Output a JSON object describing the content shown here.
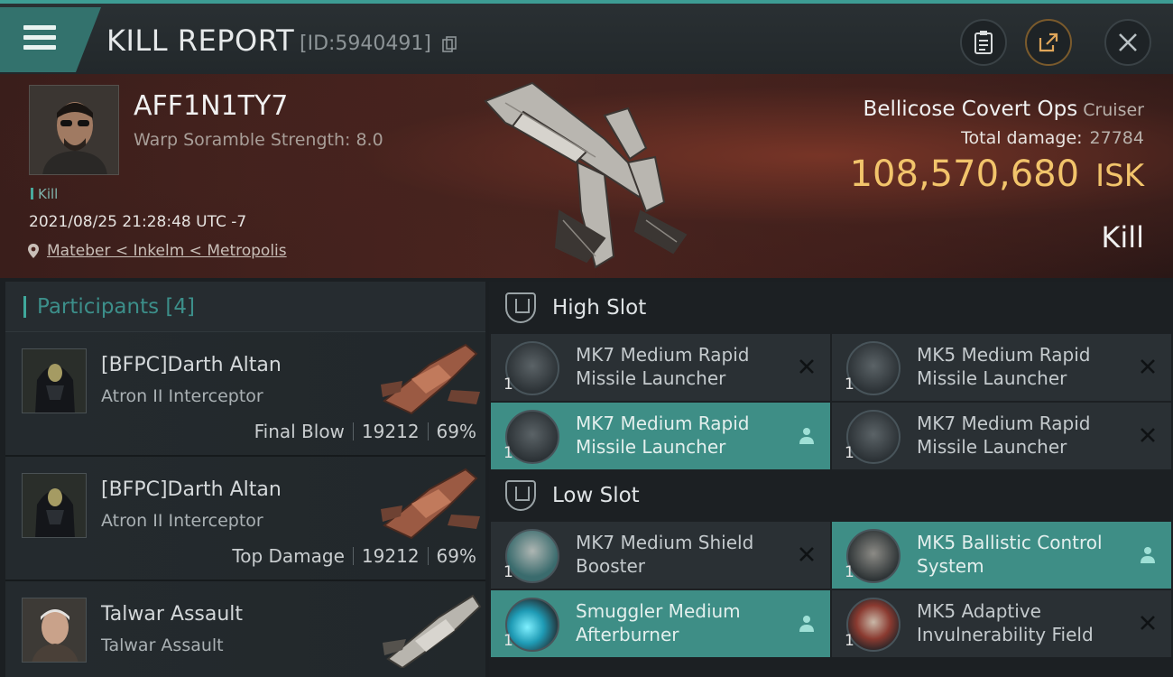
{
  "header": {
    "title": "KILL REPORT",
    "report_id": "[ID:5940491]"
  },
  "victim": {
    "name": "AFF1N1TY7",
    "scramble": "Warp Soramble Strength: 8.0",
    "tag": "Kill",
    "datetime": "2021/08/25 21:28:48 UTC -7",
    "location": "Mateber < Inkelm < Metropolis",
    "ship_name": "Bellicose Covert Ops",
    "ship_class": "Cruiser",
    "total_damage_label": "Total damage:",
    "total_damage": "27784",
    "isk_value": "108,570,680",
    "isk_unit": "ISK",
    "result": "Kill"
  },
  "participants": {
    "heading": "Participants [4]",
    "rows": [
      {
        "name": "[BFPC]Darth Altan",
        "ship": "Atron II Interceptor",
        "role": "Final Blow",
        "damage": "19212",
        "percent": "69%"
      },
      {
        "name": "[BFPC]Darth Altan",
        "ship": "Atron II Interceptor",
        "role": "Top Damage",
        "damage": "19212",
        "percent": "69%"
      },
      {
        "name": "Talwar Assault",
        "ship": "Talwar Assault",
        "role": "",
        "damage": "",
        "percent": ""
      }
    ]
  },
  "fitting": {
    "high_slot_label": "High Slot",
    "low_slot_label": "Low Slot",
    "high": [
      {
        "name": "MK7 Medium Rapid Missile Launcher",
        "qty": "1",
        "status": "destroyed"
      },
      {
        "name": "MK5 Medium Rapid Missile Launcher",
        "qty": "1",
        "status": "destroyed"
      },
      {
        "name": "MK7 Medium Rapid Missile Launcher",
        "qty": "1",
        "status": "dropped"
      },
      {
        "name": "MK7 Medium Rapid Missile Launcher",
        "qty": "1",
        "status": "destroyed"
      }
    ],
    "low": [
      {
        "name": "MK7 Medium Shield Booster",
        "qty": "1",
        "status": "destroyed"
      },
      {
        "name": "MK5 Ballistic Control System",
        "qty": "1",
        "status": "dropped"
      },
      {
        "name": "Smuggler Medium Afterburner",
        "qty": "1",
        "status": "dropped"
      },
      {
        "name": "MK5 Adaptive Invulnerability Field",
        "qty": "1",
        "status": "destroyed"
      }
    ]
  },
  "colors": {
    "accent": "#3e8e86",
    "isk": "#f2c46b",
    "banner": "#4a241f"
  }
}
